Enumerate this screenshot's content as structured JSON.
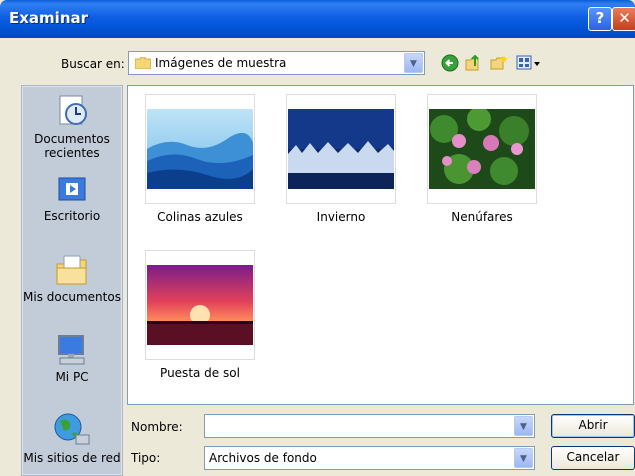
{
  "title": "Examinar",
  "lookin": {
    "label": "Buscar en:",
    "value": "Imágenes de muestra"
  },
  "places": [
    {
      "label": "Documentos\nrecientes",
      "icon": "recent-documents-icon"
    },
    {
      "label": "Escritorio",
      "icon": "desktop-icon"
    },
    {
      "label": "Mis documentos",
      "icon": "my-documents-icon"
    },
    {
      "label": "Mi PC",
      "icon": "my-computer-icon"
    },
    {
      "label": "Mis sitios de red",
      "icon": "network-places-icon"
    }
  ],
  "files": [
    {
      "name": "Colinas azules"
    },
    {
      "name": "Invierno"
    },
    {
      "name": "Nenúfares"
    },
    {
      "name": "Puesta de sol"
    }
  ],
  "filename": {
    "label": "Nombre:",
    "value": ""
  },
  "filetype": {
    "label": "Tipo:",
    "value": "Archivos de fondo"
  },
  "buttons": {
    "open": "Abrir",
    "cancel": "Cancelar"
  }
}
